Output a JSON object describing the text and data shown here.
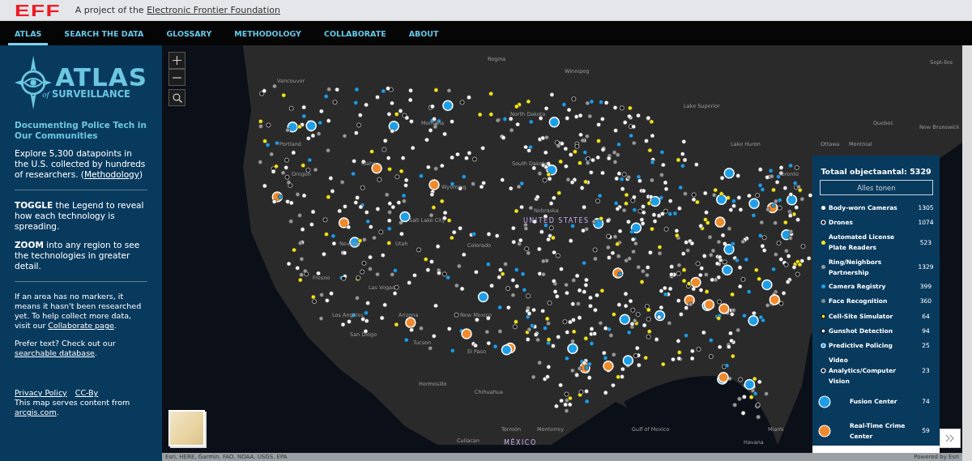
{
  "topbar": {
    "logo": "EFF",
    "tagline": "A project of the",
    "link": "Electronic Frontier Foundation"
  },
  "nav": [
    {
      "label": "ATLAS",
      "selected": true
    },
    {
      "label": "SEARCH THE DATA",
      "selected": false
    },
    {
      "label": "GLOSSARY",
      "selected": false
    },
    {
      "label": "METHODOLOGY",
      "selected": false
    },
    {
      "label": "COLLABORATE",
      "selected": false
    },
    {
      "label": "ABOUT",
      "selected": false
    }
  ],
  "sidebar": {
    "logo_title": "ATLAS",
    "logo_of": "of",
    "logo_subtitle": "SURVEILLANCE",
    "heading": "Documenting Police Tech in Our Communities",
    "intro": {
      "before": "Explore 5,300 datapoints in the U.S. collected by hundreds of researchers. (",
      "link": "Methodology",
      "after": ")"
    },
    "tips": [
      "**TOGGLE** the Legend to reveal how each technology is spreading.",
      "**ZOOM** into any region to see the technologies in greater detail."
    ],
    "notes": [
      {
        "before": "If an area has no markers, it means it hasn't been researched yet. To help collect more data, visit our ",
        "link": "Collaborate page",
        "after": "."
      },
      {
        "before": "Prefer text? Check out our ",
        "link": "searchable database",
        "after": "."
      }
    ],
    "footer_links": [
      "Privacy Policy",
      "CC-By"
    ],
    "footer": {
      "before": "This map serves content from ",
      "link": "arcgis.com",
      "after": "."
    }
  },
  "map": {
    "labels": [
      "Regina",
      "Sept-Iles",
      "Winnipeg",
      "Vancouver",
      "Lake Superior",
      "North Dakota",
      "Montana",
      "Quebec",
      "New Brunswick",
      "Portland",
      "Lake Huron",
      "Ottawa",
      "Montreal",
      "Idaho",
      "South Dakota",
      "Oregon",
      "Toronto",
      "Wyoming",
      "Nebraska",
      "Salt Lake City",
      "UNITED STATES",
      "Nevada",
      "Utah",
      "Colorado",
      "Fresno",
      "Las Vegas",
      "Los Angeles",
      "Arizona",
      "New Mexico",
      "San Diego",
      "Tucson",
      "El Paso",
      "Hermosillo",
      "Chihuahua",
      "Torreón",
      "Monterrey",
      "Gulf of Mexico",
      "Miami",
      "Culiacan",
      "MÉXICO",
      "Havana"
    ],
    "attribution": "Esri, HERE, Garmin, FAO, NOAA, USGS, EPA",
    "powered_by": "Powered by Esri",
    "legend": {
      "title": "Totaal objectaantal: 5329",
      "show_all": "Alles tonen",
      "items": [
        {
          "label": "Body-worn Cameras",
          "count": "1305",
          "kind": "dot",
          "color": "#ffffff"
        },
        {
          "label": "Drones",
          "count": "1074",
          "kind": "hollow",
          "color": "#111111"
        },
        {
          "label": "Automated License Plate Readers",
          "count": "523",
          "kind": "dot",
          "color": "#f5e71c"
        },
        {
          "label": "Ring/Neighbors Partnership",
          "count": "1329",
          "kind": "dot",
          "color": "#9a9a9a"
        },
        {
          "label": "Camera Registry",
          "count": "399",
          "kind": "dot",
          "color": "#1e9ee8"
        },
        {
          "label": "Face Recognition",
          "count": "360",
          "kind": "dot",
          "color": "#8c8c8c"
        },
        {
          "label": "Cell-Site Simulator",
          "count": "64",
          "kind": "ringed",
          "color": "#f5e71c"
        },
        {
          "label": "Gunshot Detection",
          "count": "94",
          "kind": "ringed",
          "color": "#ffffff"
        },
        {
          "label": "Predictive Policing",
          "count": "25",
          "kind": "hollow",
          "color": "#1e9ee8"
        },
        {
          "label": "Video Analytics/Computer Vision",
          "count": "23",
          "kind": "hollow",
          "color": "#111111"
        },
        {
          "label": "Fusion Center",
          "count": "74",
          "kind": "large",
          "color": "#1e9ee8"
        },
        {
          "label": "Real-Time Crime Center",
          "count": "59",
          "kind": "large",
          "color": "#f08a2c"
        }
      ]
    }
  }
}
